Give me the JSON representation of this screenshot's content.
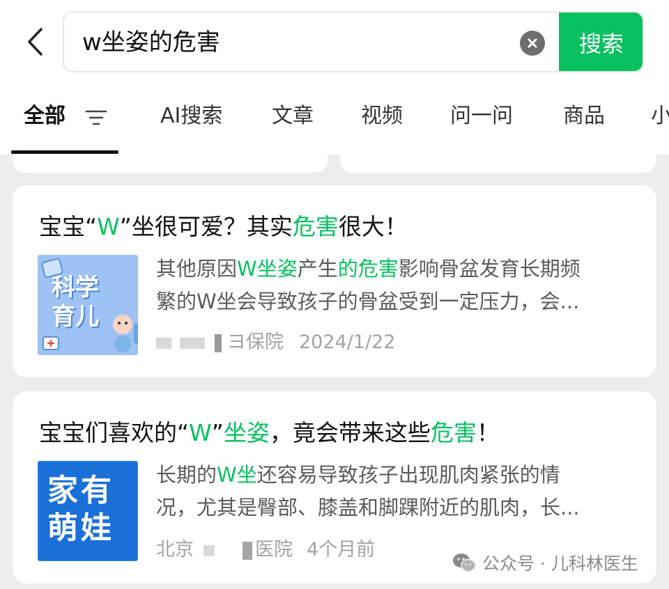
{
  "search": {
    "query": "w坐姿的危害",
    "button_label": "搜索"
  },
  "tabs": [
    {
      "label": "全部"
    },
    {
      "label": "AI搜索"
    },
    {
      "label": "文章"
    },
    {
      "label": "视频"
    },
    {
      "label": "问一问"
    },
    {
      "label": "商品"
    },
    {
      "label": "小"
    }
  ],
  "results": [
    {
      "title_parts": [
        "宝宝“",
        "W",
        "”坐很可爱？其实",
        "危害",
        "很大！"
      ],
      "thumb_text": [
        "科学",
        "育儿"
      ],
      "snippet_line1_parts": [
        "其他原因",
        "W坐姿",
        "产生",
        "的危害",
        "影响骨盆发育长期频"
      ],
      "snippet_line2": "繁的W坐会导致孩子的骨盆受到一定压力，会...",
      "source": "ヨ保院",
      "date": "2024/1/22"
    },
    {
      "title_parts": [
        "宝宝们喜欢的“",
        "W",
        "”",
        "坐姿",
        "，竟会带来这些",
        "危害",
        "！"
      ],
      "thumb_text": [
        "家有",
        "萌娃"
      ],
      "snippet_line1_parts": [
        "长期的",
        "W坐",
        "还容易导致孩子出现肌肉紧张的情"
      ],
      "snippet_line2": "况，尤其是臀部、膝盖和脚踝附近的肌肉，长...",
      "source_prefix": "北京",
      "source": "医院",
      "date": "4个月前"
    }
  ],
  "watermark": "公众号 · 儿科林医生",
  "colors": {
    "accent": "#07c160",
    "background": "#ededed",
    "card": "#ffffff",
    "thumb1": "#8fb8f0",
    "thumb2": "#1a6fd6"
  }
}
